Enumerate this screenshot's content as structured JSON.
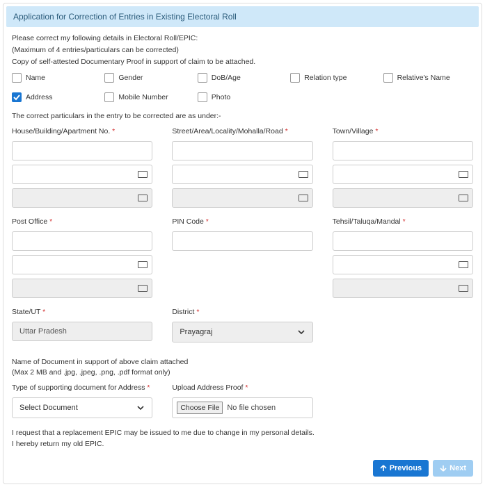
{
  "header": {
    "title": "Application for Correction of Entries in Existing Electoral Roll"
  },
  "intro": {
    "line1": "Please correct my following details in Electoral Roll/EPIC:",
    "line2": "(Maximum of 4 entries/particulars can be corrected)",
    "line3": "Copy of self-attested Documentary Proof in support of claim to be attached."
  },
  "checkboxes": {
    "name": "Name",
    "gender": "Gender",
    "dob": "DoB/Age",
    "relation_type": "Relation type",
    "relative_name": "Relative's Name",
    "address": "Address",
    "mobile": "Mobile Number",
    "photo": "Photo"
  },
  "subheading": "The correct particulars in the entry to be corrected are as under:-",
  "fields": {
    "house": "House/Building/Apartment No.",
    "street": "Street/Area/Locality/Mohalla/Road",
    "town": "Town/Village",
    "post_office": "Post Office",
    "pin": "PIN Code",
    "tehsil": "Tehsil/Taluqa/Mandal",
    "state": "State/UT",
    "district": "District"
  },
  "values": {
    "state": "Uttar Pradesh",
    "district": "Prayagraj"
  },
  "doc": {
    "name_label": "Name of Document in support of above claim attached",
    "format_note": "(Max 2 MB and .jpg, .jpeg, .png, .pdf format only)",
    "support_type_label": "Type of supporting document for Address",
    "support_type_value": "Select Document",
    "upload_label": "Upload Address Proof",
    "choose_file": "Choose File",
    "no_file": "No file chosen"
  },
  "declaration": {
    "line1": "I request that a replacement EPIC may be issued to me due to change in my personal details.",
    "line2": "I hereby return my old EPIC."
  },
  "buttons": {
    "previous": "Previous",
    "next": "Next"
  },
  "required_mark": "*"
}
